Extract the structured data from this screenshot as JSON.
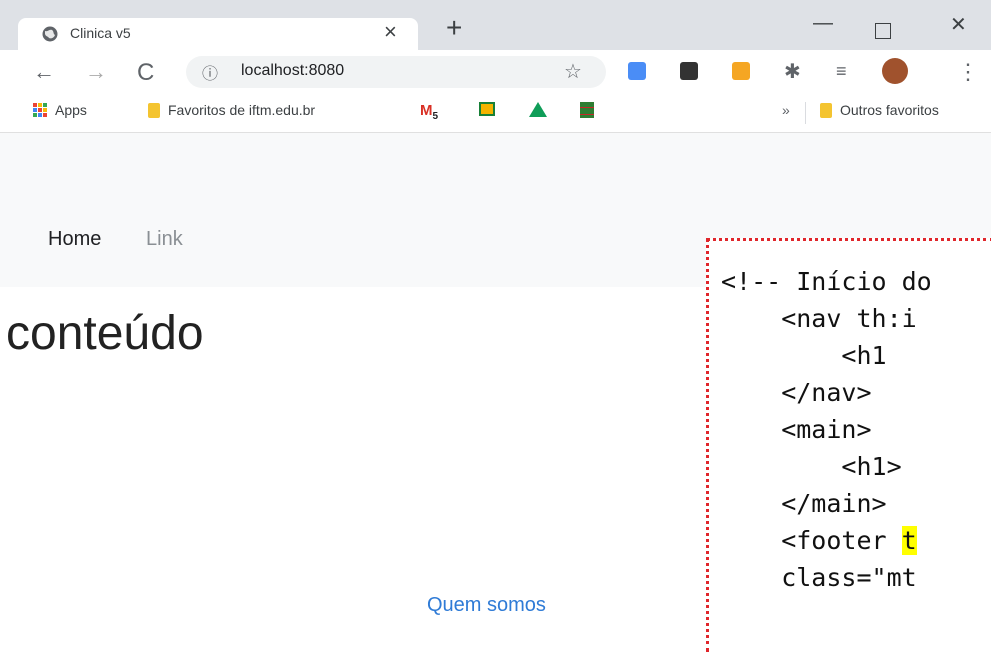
{
  "browser": {
    "tab": {
      "title": "Clinica v5"
    },
    "toolbar": {
      "url": "localhost:8080"
    },
    "bookmarks": {
      "apps": "Apps",
      "favoritos_iftm": "Favoritos de iftm.edu.br",
      "gmail_badge": "5",
      "overflow": "»",
      "outros": "Outros favoritos"
    }
  },
  "page": {
    "nav": {
      "home": "Home",
      "link": "Link"
    },
    "title": "conteúdo",
    "footer": "Quem somos"
  },
  "code": {
    "lines": [
      "<!-- Início do",
      "    <nav th:i",
      "        <h1",
      "    </nav>",
      "    <main>",
      "        <h1>",
      "    </main>",
      "    <footer ",
      "    class=\"mt"
    ],
    "footer_highlight": "t"
  },
  "colors": {
    "accent_link": "#2f7bd6",
    "dotted_border": "#e0262b",
    "highlight": "#ffff00"
  }
}
